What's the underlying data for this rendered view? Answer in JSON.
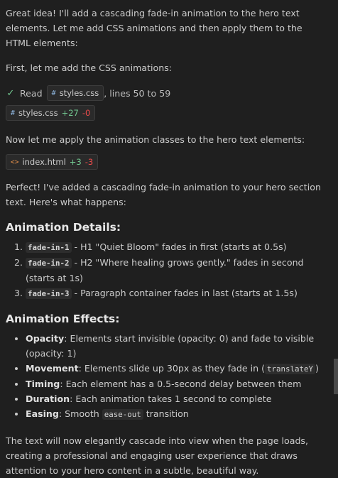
{
  "intro": "Great idea! I'll add a cascading fade-in animation to the hero text elements. Let me add CSS animations and then apply them to the HTML elements:",
  "first_line": "First, let me add the CSS animations:",
  "read_tool": {
    "status_icon": "check-icon",
    "action": "Read",
    "file": "styles.css",
    "detail": ", lines 50 to 59"
  },
  "edit_css": {
    "file": "styles.css",
    "added": "+27",
    "removed": "-0",
    "icon": "css-file-icon"
  },
  "apply_line": "Now let me apply the animation classes to the hero text elements:",
  "edit_html": {
    "file": "index.html",
    "added": "+3",
    "removed": "-3",
    "icon": "html-file-icon"
  },
  "summary": "Perfect! I've added a cascading fade-in animation to your hero section text. Here's what happens:",
  "details": {
    "heading": "Animation Details:",
    "items": [
      {
        "code": "fade-in-1",
        "text": " - H1 \"Quiet Bloom\" fades in first (starts at 0.5s)"
      },
      {
        "code": "fade-in-2",
        "text": " - H2 \"Where healing grows gently.\" fades in second (starts at 1s)"
      },
      {
        "code": "fade-in-3",
        "text": " - Paragraph container fades in last (starts at 1.5s)"
      }
    ]
  },
  "effects": {
    "heading": "Animation Effects:",
    "items": [
      {
        "label": "Opacity",
        "text": ": Elements start invisible (opacity: 0) and fade to visible (opacity: 1)"
      },
      {
        "label": "Movement",
        "text": ": Elements slide up 30px as they fade in (",
        "code": "translateY",
        "after": ")"
      },
      {
        "label": "Timing",
        "text": ": Each element has a 0.5-second delay between them"
      },
      {
        "label": "Duration",
        "text": ": Each animation takes 1 second to complete"
      },
      {
        "label": "Easing",
        "text": ": Smooth ",
        "code": "ease-out",
        "after": " transition"
      }
    ]
  },
  "closing": "The text will now elegantly cascade into view when the page loads, creating a professional and engaging user experience that draws attention to your hero content in a subtle, beautiful way."
}
